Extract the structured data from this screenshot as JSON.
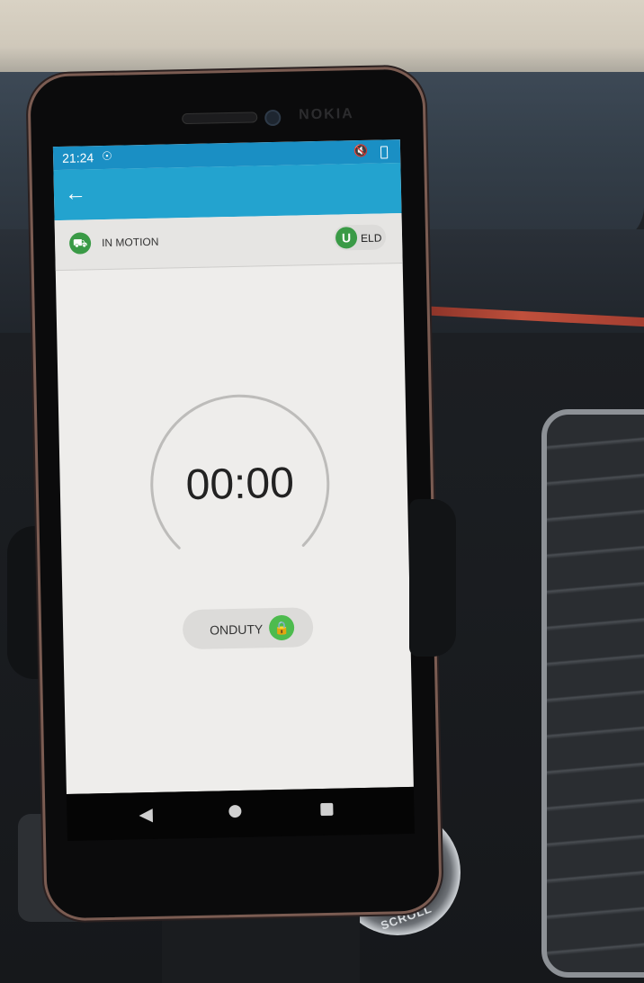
{
  "status_bar": {
    "time": "21:24",
    "notification_icon": "notification-icon",
    "mute_icon": "mute-icon",
    "battery_icon": "battery-icon"
  },
  "app_bar": {
    "back_icon": "arrow-left-icon"
  },
  "status_strip": {
    "motion_label": "IN MOTION",
    "motion_icon": "truck-icon",
    "eld_label": "ELD"
  },
  "timer": {
    "value": "00:00"
  },
  "duty": {
    "label": "ONDUTY",
    "lock_icon": "lock-icon"
  },
  "phone": {
    "brand": "NOKIA"
  },
  "dashboard": {
    "knob_label": "SCROLL"
  },
  "colors": {
    "status_bar": "#1a8fc4",
    "app_bar": "#23a3cf",
    "accent_green": "#3a9a46",
    "lock_green": "#4dbb4e",
    "screen_bg": "#eeedeb"
  }
}
